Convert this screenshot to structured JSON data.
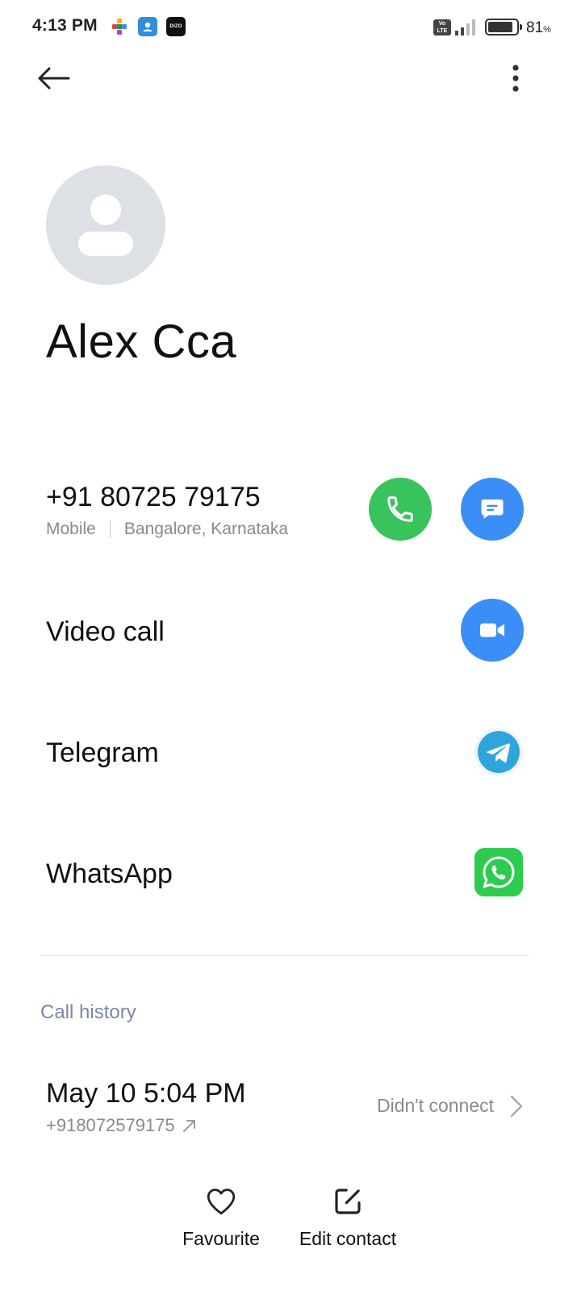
{
  "status_bar": {
    "time": "4:13 PM",
    "notification_icons": [
      "puzzle-app-icon",
      "contacts-app-icon",
      "dizo-app-icon"
    ],
    "dizo_label": "DIZO",
    "network_badge": "Vo LTE",
    "battery_level": "81",
    "battery_unit": "%"
  },
  "header": {
    "back_icon": "arrow-left-icon",
    "menu_icon": "more-vertical-icon"
  },
  "contact": {
    "name": "Alex Cca",
    "avatar_icon": "person-placeholder-icon"
  },
  "phone": {
    "number": "+91 80725 79175",
    "type": "Mobile",
    "location": "Bangalore, Karnataka",
    "actions": [
      "phone-icon",
      "message-icon"
    ]
  },
  "apps": [
    {
      "label": "Video call",
      "icon": "video-camera-icon"
    },
    {
      "label": "Telegram",
      "icon": "telegram-icon"
    },
    {
      "label": "WhatsApp",
      "icon": "whatsapp-icon"
    }
  ],
  "call_history": {
    "title": "Call history",
    "entries": [
      {
        "date": "May 10 5:04 PM",
        "number": "+918072579175",
        "direction_icon": "outgoing-arrow-icon",
        "status": "Didn't connect"
      }
    ]
  },
  "bottom_actions": [
    {
      "label": "Favourite",
      "icon": "heart-icon"
    },
    {
      "label": "Edit contact",
      "icon": "edit-icon"
    }
  ],
  "colors": {
    "call_green": "#39c35c",
    "message_blue": "#3b8ef6",
    "whatsapp_green": "#2ecc4e",
    "telegram_blue": "#2ea6dd",
    "section_title": "#7d86a8",
    "avatar_bg": "#dde0e5"
  }
}
